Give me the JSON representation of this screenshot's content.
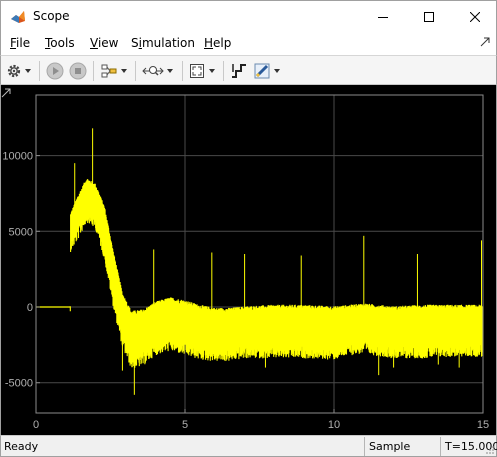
{
  "window": {
    "title": "Scope",
    "controls": [
      "minimize-icon",
      "maximize-icon",
      "close-icon"
    ]
  },
  "menu": {
    "items": [
      {
        "label": "File",
        "mnemonic": "F",
        "rest": "ile"
      },
      {
        "label": "Tools",
        "mnemonic": "T",
        "rest": "ools"
      },
      {
        "label": "View",
        "mnemonic": "V",
        "rest": "iew"
      },
      {
        "label": "Simulation",
        "mnemonic": "S",
        "pre": "",
        "mn": "i",
        "full": "Simulation"
      },
      {
        "label": "Help",
        "mnemonic": "H",
        "rest": "elp"
      }
    ]
  },
  "toolbar": {
    "buttons": [
      "gear-icon",
      "run-icon",
      "stop-icon",
      "signal-select-icon",
      "zoom-icon",
      "fit-axes-icon",
      "cursor-measure-icon",
      "highlight-icon"
    ]
  },
  "colors": {
    "trace": "#ffff00",
    "background": "#000000",
    "grid": "#4a4a4a",
    "tick_text": "#b0b0b0"
  },
  "chart_data": {
    "type": "line",
    "title": "",
    "xlabel": "",
    "ylabel": "",
    "xlim": [
      0,
      15
    ],
    "ylim": [
      -7000,
      14000
    ],
    "x_ticks": [
      0,
      5,
      10,
      15
    ],
    "y_ticks": [
      10000,
      5000,
      0,
      -5000
    ],
    "x_tick_labels": [
      "0",
      "5",
      "10",
      "15"
    ],
    "y_tick_labels": [
      "10000",
      "5000",
      "0",
      "-5000"
    ],
    "grid": true,
    "series": [
      {
        "envelope_upper": [
          [
            0,
            0
          ],
          [
            1.15,
            0
          ],
          [
            1.15,
            6000
          ],
          [
            1.4,
            7200
          ],
          [
            1.7,
            8400
          ],
          [
            2.0,
            8000
          ],
          [
            2.3,
            6500
          ],
          [
            2.6,
            3500
          ],
          [
            2.9,
            800
          ],
          [
            3.2,
            -400
          ],
          [
            3.6,
            -300
          ],
          [
            4.0,
            200
          ],
          [
            4.5,
            500
          ],
          [
            5.0,
            300
          ],
          [
            5.5,
            0
          ],
          [
            6.0,
            -200
          ],
          [
            6.5,
            -200
          ],
          [
            7.0,
            -100
          ],
          [
            8.0,
            0
          ],
          [
            9.0,
            0
          ],
          [
            10.0,
            -100
          ],
          [
            10.5,
            0
          ],
          [
            11.0,
            100
          ],
          [
            12.0,
            -100
          ],
          [
            13.0,
            0
          ],
          [
            14.0,
            0
          ],
          [
            15.0,
            0
          ]
        ],
        "envelope_lower": [
          [
            0,
            0
          ],
          [
            1.15,
            0
          ],
          [
            1.15,
            4500
          ],
          [
            1.4,
            5300
          ],
          [
            1.7,
            6500
          ],
          [
            2.0,
            6000
          ],
          [
            2.3,
            4000
          ],
          [
            2.6,
            800
          ],
          [
            2.9,
            -1800
          ],
          [
            3.2,
            -3200
          ],
          [
            3.6,
            -3000
          ],
          [
            4.0,
            -2300
          ],
          [
            4.5,
            -2000
          ],
          [
            5.0,
            -2300
          ],
          [
            5.5,
            -2600
          ],
          [
            6.0,
            -2700
          ],
          [
            6.5,
            -2700
          ],
          [
            7.0,
            -2500
          ],
          [
            8.0,
            -2500
          ],
          [
            9.0,
            -2500
          ],
          [
            10.0,
            -2600
          ],
          [
            10.5,
            -2300
          ],
          [
            11.0,
            -2200
          ],
          [
            12.0,
            -2500
          ],
          [
            13.0,
            -2500
          ],
          [
            14.0,
            -2400
          ],
          [
            15.0,
            -2400
          ]
        ],
        "spikes": [
          [
            1.3,
            9500
          ],
          [
            1.9,
            11800
          ],
          [
            3.3,
            -5800
          ],
          [
            2.9,
            -4200
          ],
          [
            3.95,
            3800
          ],
          [
            5.9,
            3600
          ],
          [
            7.0,
            3500
          ],
          [
            7.7,
            -4000
          ],
          [
            8.9,
            3400
          ],
          [
            11.0,
            4700
          ],
          [
            11.5,
            -4500
          ],
          [
            12.0,
            -4000
          ],
          [
            12.8,
            3500
          ],
          [
            13.5,
            -3800
          ],
          [
            14.2,
            -4000
          ],
          [
            14.95,
            4400
          ]
        ]
      }
    ]
  },
  "status": {
    "left": "Ready",
    "mode": "Sample based",
    "time": "T=15.000"
  }
}
